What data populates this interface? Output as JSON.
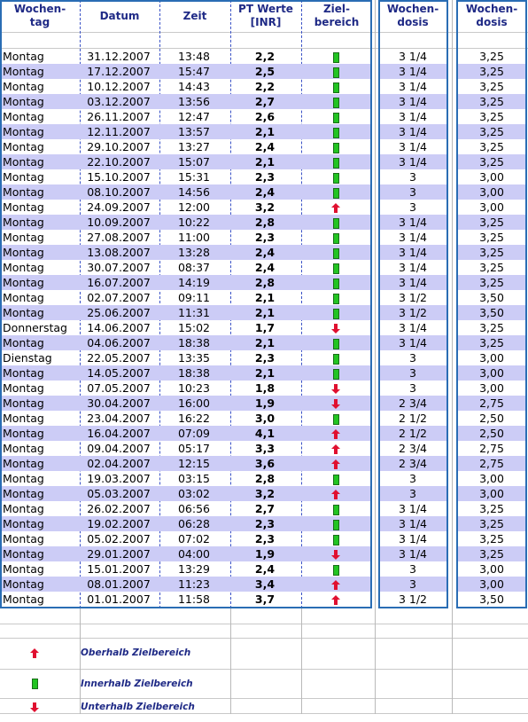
{
  "headers": {
    "wochentag": "Wochen-\ntag",
    "datum": "Datum",
    "zeit": "Zeit",
    "pt": "PT Werte\n[INR]",
    "ziel": "Ziel-\nbereich",
    "wochendosis": "Wochen-\ndosis",
    "wochendosis2": "Wochen-\ndosis"
  },
  "status_colors": {
    "oberhalb": "#e01030",
    "innerhalb": "#22c422",
    "unterhalb": "#e01030"
  },
  "rows": [
    {
      "day": "Montag",
      "date": "31.12.2007",
      "time": "13:48",
      "pt": "2,2",
      "status": "innerhalb",
      "dose": "3 1/4",
      "dose_dec": "3,25"
    },
    {
      "day": "Montag",
      "date": "17.12.2007",
      "time": "15:47",
      "pt": "2,5",
      "status": "innerhalb",
      "dose": "3 1/4",
      "dose_dec": "3,25"
    },
    {
      "day": "Montag",
      "date": "10.12.2007",
      "time": "14:43",
      "pt": "2,2",
      "status": "innerhalb",
      "dose": "3 1/4",
      "dose_dec": "3,25"
    },
    {
      "day": "Montag",
      "date": "03.12.2007",
      "time": "13:56",
      "pt": "2,7",
      "status": "innerhalb",
      "dose": "3 1/4",
      "dose_dec": "3,25"
    },
    {
      "day": "Montag",
      "date": "26.11.2007",
      "time": "12:47",
      "pt": "2,6",
      "status": "innerhalb",
      "dose": "3 1/4",
      "dose_dec": "3,25"
    },
    {
      "day": "Montag",
      "date": "12.11.2007",
      "time": "13:57",
      "pt": "2,1",
      "status": "innerhalb",
      "dose": "3 1/4",
      "dose_dec": "3,25"
    },
    {
      "day": "Montag",
      "date": "29.10.2007",
      "time": "13:27",
      "pt": "2,4",
      "status": "innerhalb",
      "dose": "3 1/4",
      "dose_dec": "3,25"
    },
    {
      "day": "Montag",
      "date": "22.10.2007",
      "time": "15:07",
      "pt": "2,1",
      "status": "innerhalb",
      "dose": "3 1/4",
      "dose_dec": "3,25"
    },
    {
      "day": "Montag",
      "date": "15.10.2007",
      "time": "15:31",
      "pt": "2,3",
      "status": "innerhalb",
      "dose": "3",
      "dose_dec": "3,00"
    },
    {
      "day": "Montag",
      "date": "08.10.2007",
      "time": "14:56",
      "pt": "2,4",
      "status": "innerhalb",
      "dose": "3",
      "dose_dec": "3,00"
    },
    {
      "day": "Montag",
      "date": "24.09.2007",
      "time": "12:00",
      "pt": "3,2",
      "status": "oberhalb",
      "dose": "3",
      "dose_dec": "3,00"
    },
    {
      "day": "Montag",
      "date": "10.09.2007",
      "time": "10:22",
      "pt": "2,8",
      "status": "innerhalb",
      "dose": "3 1/4",
      "dose_dec": "3,25"
    },
    {
      "day": "Montag",
      "date": "27.08.2007",
      "time": "11:00",
      "pt": "2,3",
      "status": "innerhalb",
      "dose": "3 1/4",
      "dose_dec": "3,25"
    },
    {
      "day": "Montag",
      "date": "13.08.2007",
      "time": "13:28",
      "pt": "2,4",
      "status": "innerhalb",
      "dose": "3 1/4",
      "dose_dec": "3,25"
    },
    {
      "day": "Montag",
      "date": "30.07.2007",
      "time": "08:37",
      "pt": "2,4",
      "status": "innerhalb",
      "dose": "3 1/4",
      "dose_dec": "3,25"
    },
    {
      "day": "Montag",
      "date": "16.07.2007",
      "time": "14:19",
      "pt": "2,8",
      "status": "innerhalb",
      "dose": "3 1/4",
      "dose_dec": "3,25"
    },
    {
      "day": "Montag",
      "date": "02.07.2007",
      "time": "09:11",
      "pt": "2,1",
      "status": "innerhalb",
      "dose": "3 1/2",
      "dose_dec": "3,50"
    },
    {
      "day": "Montag",
      "date": "25.06.2007",
      "time": "11:31",
      "pt": "2,1",
      "status": "innerhalb",
      "dose": "3 1/2",
      "dose_dec": "3,50"
    },
    {
      "day": "Donnerstag",
      "date": "14.06.2007",
      "time": "15:02",
      "pt": "1,7",
      "status": "unterhalb",
      "dose": "3 1/4",
      "dose_dec": "3,25"
    },
    {
      "day": "Montag",
      "date": "04.06.2007",
      "time": "18:38",
      "pt": "2,1",
      "status": "innerhalb",
      "dose": "3 1/4",
      "dose_dec": "3,25"
    },
    {
      "day": "Dienstag",
      "date": "22.05.2007",
      "time": "13:35",
      "pt": "2,3",
      "status": "innerhalb",
      "dose": "3",
      "dose_dec": "3,00"
    },
    {
      "day": "Montag",
      "date": "14.05.2007",
      "time": "18:38",
      "pt": "2,1",
      "status": "innerhalb",
      "dose": "3",
      "dose_dec": "3,00"
    },
    {
      "day": "Montag",
      "date": "07.05.2007",
      "time": "10:23",
      "pt": "1,8",
      "status": "unterhalb",
      "dose": "3",
      "dose_dec": "3,00"
    },
    {
      "day": "Montag",
      "date": "30.04.2007",
      "time": "16:00",
      "pt": "1,9",
      "status": "unterhalb",
      "dose": "2 3/4",
      "dose_dec": "2,75"
    },
    {
      "day": "Montag",
      "date": "23.04.2007",
      "time": "16:22",
      "pt": "3,0",
      "status": "innerhalb",
      "dose": "2 1/2",
      "dose_dec": "2,50"
    },
    {
      "day": "Montag",
      "date": "16.04.2007",
      "time": "07:09",
      "pt": "4,1",
      "status": "oberhalb",
      "dose": "2 1/2",
      "dose_dec": "2,50"
    },
    {
      "day": "Montag",
      "date": "09.04.2007",
      "time": "05:17",
      "pt": "3,3",
      "status": "oberhalb",
      "dose": "2 3/4",
      "dose_dec": "2,75"
    },
    {
      "day": "Montag",
      "date": "02.04.2007",
      "time": "12:15",
      "pt": "3,6",
      "status": "oberhalb",
      "dose": "2 3/4",
      "dose_dec": "2,75"
    },
    {
      "day": "Montag",
      "date": "19.03.2007",
      "time": "03:15",
      "pt": "2,8",
      "status": "innerhalb",
      "dose": "3",
      "dose_dec": "3,00"
    },
    {
      "day": "Montag",
      "date": "05.03.2007",
      "time": "03:02",
      "pt": "3,2",
      "status": "oberhalb",
      "dose": "3",
      "dose_dec": "3,00"
    },
    {
      "day": "Montag",
      "date": "26.02.2007",
      "time": "06:56",
      "pt": "2,7",
      "status": "innerhalb",
      "dose": "3 1/4",
      "dose_dec": "3,25"
    },
    {
      "day": "Montag",
      "date": "19.02.2007",
      "time": "06:28",
      "pt": "2,3",
      "status": "innerhalb",
      "dose": "3 1/4",
      "dose_dec": "3,25"
    },
    {
      "day": "Montag",
      "date": "05.02.2007",
      "time": "07:02",
      "pt": "2,3",
      "status": "innerhalb",
      "dose": "3 1/4",
      "dose_dec": "3,25"
    },
    {
      "day": "Montag",
      "date": "29.01.2007",
      "time": "04:00",
      "pt": "1,9",
      "status": "unterhalb",
      "dose": "3 1/4",
      "dose_dec": "3,25"
    },
    {
      "day": "Montag",
      "date": "15.01.2007",
      "time": "13:29",
      "pt": "2,4",
      "status": "innerhalb",
      "dose": "3",
      "dose_dec": "3,00"
    },
    {
      "day": "Montag",
      "date": "08.01.2007",
      "time": "11:23",
      "pt": "3,4",
      "status": "oberhalb",
      "dose": "3",
      "dose_dec": "3,00"
    },
    {
      "day": "Montag",
      "date": "01.01.2007",
      "time": "11:58",
      "pt": "3,7",
      "status": "oberhalb",
      "dose": "3 1/2",
      "dose_dec": "3,50"
    }
  ],
  "legend": [
    {
      "status": "oberhalb",
      "label": "Oberhalb Zielbereich"
    },
    {
      "status": "innerhalb",
      "label": "Innerhalb Zielbereich"
    },
    {
      "status": "unterhalb",
      "label": "Unterhalb Zielbereich"
    }
  ]
}
